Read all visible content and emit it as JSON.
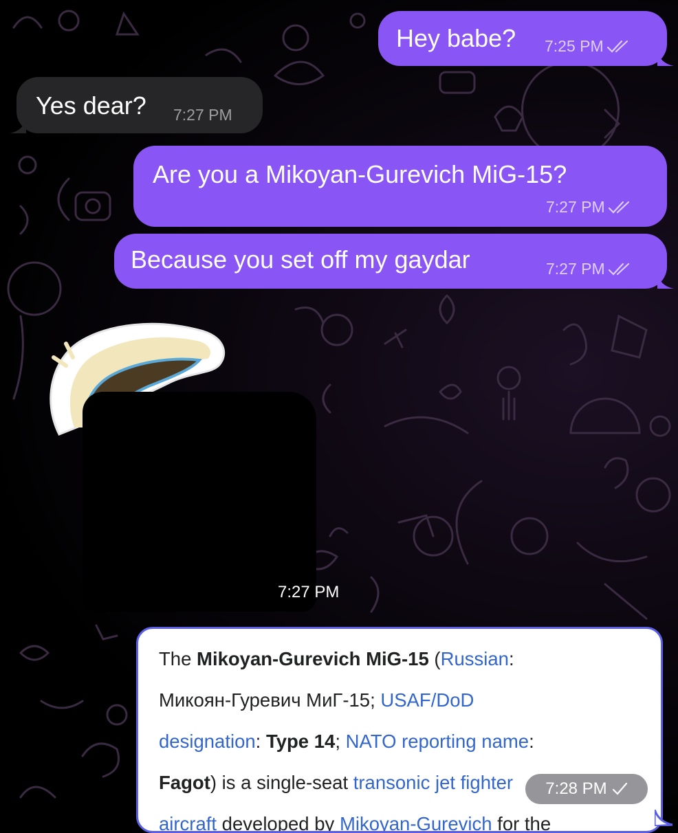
{
  "messages": [
    {
      "text": "Hey babe?",
      "time": "7:25 PM",
      "status": "read"
    },
    {
      "text": "Yes dear?",
      "time": "7:27 PM"
    },
    {
      "text": "Are you a Mikoyan-Gurevich MiG-15?",
      "time": "7:27 PM",
      "status": "read"
    },
    {
      "text": "Because you set off my gaydar",
      "time": "7:27 PM",
      "status": "read"
    }
  ],
  "sticker": {
    "time": "7:27 PM"
  },
  "wiki_card": {
    "time": "7:28 PM",
    "status": "sent",
    "lines": [
      {
        "t1": "The ",
        "b1": "Mikoyan-Gurevich MiG-15",
        "t2": " (",
        "l1": "Russian",
        "t3": ":"
      },
      {
        "t1": "Микоян-Гуревич МиГ-15; ",
        "l1": "USAF/DoD"
      },
      {
        "l1": "designation",
        "t1": ": ",
        "b1": "Type 14",
        "t2": "; ",
        "l2": "NATO reporting name",
        "t3": ":"
      },
      {
        "b1": "Fagot",
        "t1": ") is a single-seat ",
        "l1": "transonic jet fighter"
      },
      {
        "l1": "aircraft",
        "t1": " developed by ",
        "l2": "Mikoyan-Gurevich",
        "t2": " for the"
      }
    ]
  },
  "colors": {
    "outgoing_bubble": "#8a55f5",
    "incoming_bubble": "#262628",
    "link": "#3366cc",
    "card_border": "#5b5fe6"
  },
  "icons": {
    "read_receipt": "double-check-icon",
    "sent_receipt": "single-check-icon"
  }
}
